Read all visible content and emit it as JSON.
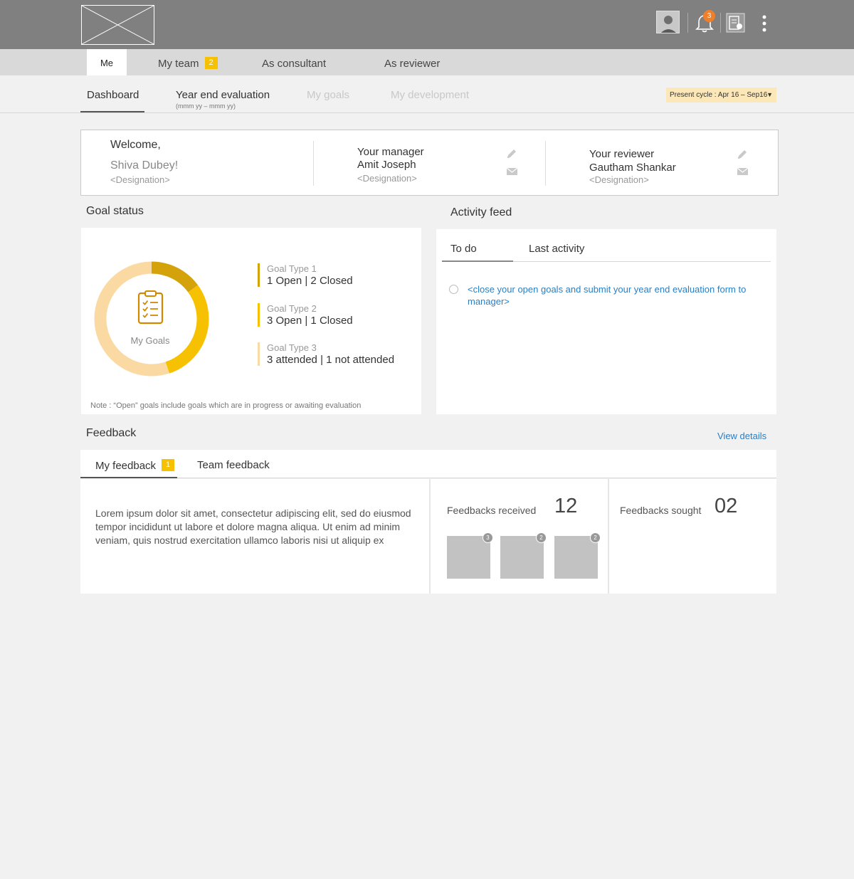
{
  "header": {
    "notification_count": "3"
  },
  "primary_tabs": [
    {
      "label": "Me"
    },
    {
      "label": "My team",
      "badge": "2"
    },
    {
      "label": "As consultant"
    },
    {
      "label": "As reviewer"
    }
  ],
  "secondary_tabs": [
    {
      "label": "Dashboard"
    },
    {
      "label": "Year end evaluation",
      "sub": "(mmm yy – mmm yy)"
    },
    {
      "label": "My goals"
    },
    {
      "label": "My development"
    }
  ],
  "cycle": {
    "label": "Present cycle : Apr 16 – Sep16"
  },
  "welcome": {
    "greeting": "Welcome,",
    "name": "Shiva Dubey!",
    "designation": "<Designation>"
  },
  "manager": {
    "label": "Your manager",
    "name": "Amit Joseph",
    "designation": "<Designation>"
  },
  "reviewer": {
    "label": "Your reviewer",
    "name": "Gautham Shankar",
    "designation": "<Designation>"
  },
  "goal_status": {
    "title": "Goal status",
    "center_label": "My Goals",
    "types": [
      {
        "name": "Goal Type 1",
        "value": "1 Open | 2 Closed",
        "color": "#d4a20a"
      },
      {
        "name": "Goal Type 2",
        "value": "3 Open | 1 Closed",
        "color": "#f5c100"
      },
      {
        "name": "Goal Type 3",
        "value": "3 attended | 1 not attended",
        "color": "#fbd9a2"
      }
    ],
    "ring_fractions": [
      0.15,
      0.3,
      0.55
    ],
    "note": "Note : “Open” goals include goals which are in progress or awaiting evaluation"
  },
  "activity_feed": {
    "title": "Activity feed",
    "tabs": [
      "To do",
      "Last activity"
    ],
    "todo_item": "<close your open goals and submit your year end evaluation form to manager>"
  },
  "feedback": {
    "title": "Feedback",
    "view_details": "View details",
    "tabs": [
      {
        "label": "My feedback",
        "badge": "1"
      },
      {
        "label": "Team feedback"
      }
    ],
    "body_text": "Lorem ipsum dolor sit amet, consectetur adipiscing elit, sed do eiusmod tempor incididunt ut labore et dolore magna aliqua. Ut enim ad minim veniam, quis nostrud exercitation ullamco laboris nisi ut aliquip ex",
    "received_label": "Feedbacks received",
    "received_count": "12",
    "received_thumbs": [
      "3",
      "2",
      "2"
    ],
    "sought_label": "Feedbacks sought",
    "sought_count": "02"
  }
}
